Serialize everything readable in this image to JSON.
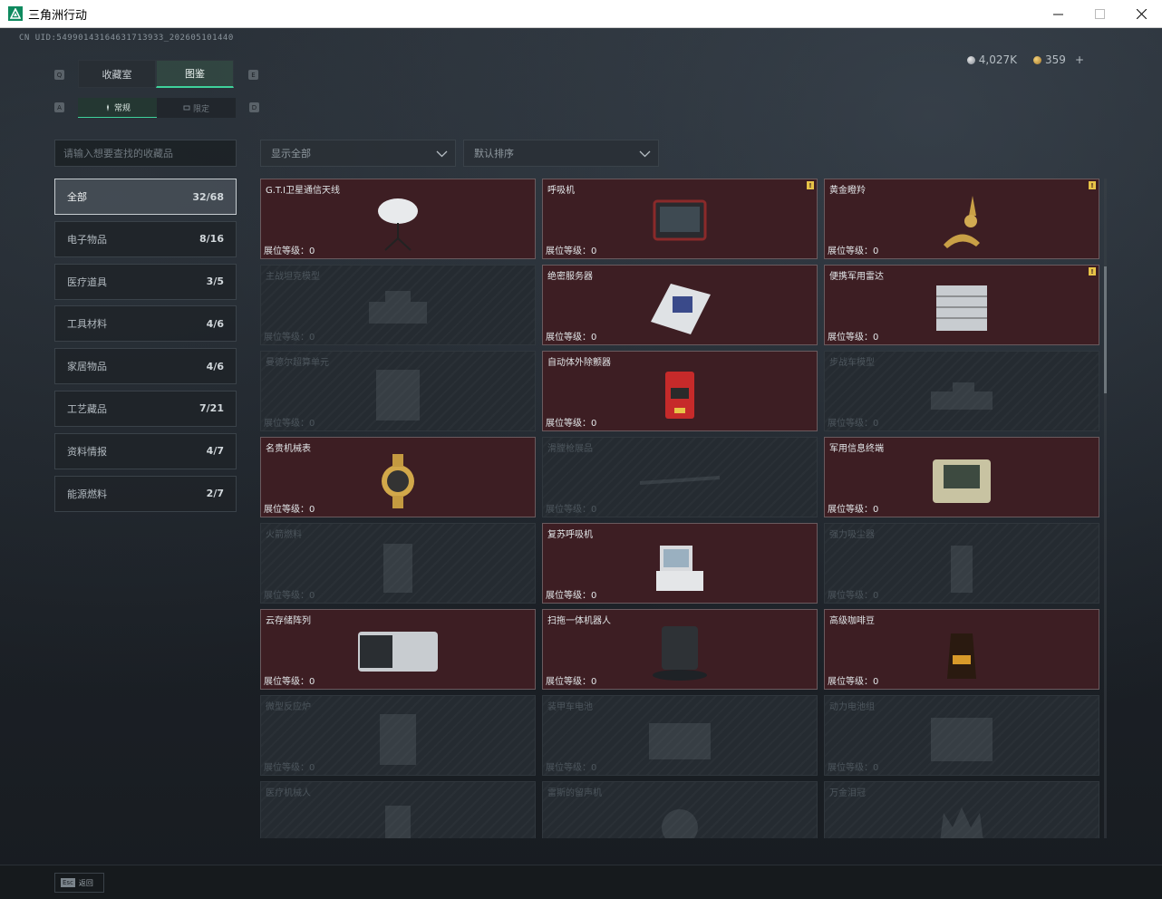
{
  "window": {
    "title": "三角洲行动"
  },
  "uid": "CN UID:5499014316463171393​3_202605101440",
  "currency": {
    "silver": "4,027K",
    "gold": "359",
    "plus": "+"
  },
  "tabs": [
    {
      "label": "收藏室",
      "active": false
    },
    {
      "label": "图鉴",
      "active": true
    }
  ],
  "subtabs": [
    {
      "label": "常规",
      "active": true
    },
    {
      "label": "限定",
      "active": false
    }
  ],
  "key_hints": {
    "q": "Q",
    "e": "E",
    "a": "A",
    "d": "D"
  },
  "search": {
    "placeholder": "请输入想要查找的收藏品"
  },
  "filters": {
    "show": "显示全部",
    "sort": "默认排序"
  },
  "categories": [
    {
      "label": "全部",
      "count": "32/68",
      "active": true
    },
    {
      "label": "电子物品",
      "count": "8/16"
    },
    {
      "label": "医疗道具",
      "count": "3/5"
    },
    {
      "label": "工具材料",
      "count": "4/6"
    },
    {
      "label": "家居物品",
      "count": "4/6"
    },
    {
      "label": "工艺藏品",
      "count": "7/21"
    },
    {
      "label": "资料情报",
      "count": "4/7"
    },
    {
      "label": "能源燃料",
      "count": "2/7"
    }
  ],
  "items": [
    {
      "name": "G.T.I卫星通信天线",
      "level": "展位等级：0",
      "owned": true,
      "flag": false,
      "icon": "satellite-dish"
    },
    {
      "name": "呼吸机",
      "level": "展位等级：0",
      "owned": true,
      "flag": true,
      "icon": "ventilator"
    },
    {
      "name": "黄金瞪羚",
      "level": "展位等级：0",
      "owned": true,
      "flag": true,
      "icon": "gold-gazelle"
    },
    {
      "name": "主战坦克模型",
      "level": "展位等级：0",
      "owned": false,
      "flag": false,
      "icon": "tank-model"
    },
    {
      "name": "绝密服务器",
      "level": "展位等级：0",
      "owned": true,
      "flag": false,
      "icon": "server"
    },
    {
      "name": "便携军用雷达",
      "level": "展位等级：0",
      "owned": true,
      "flag": true,
      "icon": "radar"
    },
    {
      "name": "曼德尔超算单元",
      "level": "展位等级：0",
      "owned": false,
      "flag": false,
      "icon": "supercomputer"
    },
    {
      "name": "自动体外除颤器",
      "level": "展位等级：0",
      "owned": true,
      "flag": false,
      "icon": "defibrillator"
    },
    {
      "name": "步战车模型",
      "level": "展位等级：0",
      "owned": false,
      "flag": false,
      "icon": "ifv-model"
    },
    {
      "name": "名贵机械表",
      "level": "展位等级：0",
      "owned": true,
      "flag": false,
      "icon": "watch"
    },
    {
      "name": "滑膛枪展品",
      "level": "展位等级：0",
      "owned": false,
      "flag": false,
      "icon": "musket"
    },
    {
      "name": "军用信息终端",
      "level": "展位等级：0",
      "owned": true,
      "flag": false,
      "icon": "terminal"
    },
    {
      "name": "火箭燃料",
      "level": "展位等级：0",
      "owned": false,
      "flag": false,
      "icon": "rocket-fuel"
    },
    {
      "name": "复苏呼吸机",
      "level": "展位等级：0",
      "owned": true,
      "flag": false,
      "icon": "resus-ventilator"
    },
    {
      "name": "强力吸尘器",
      "level": "展位等级：0",
      "owned": false,
      "flag": false,
      "icon": "vacuum"
    },
    {
      "name": "云存储阵列",
      "level": "展位等级：0",
      "owned": true,
      "flag": false,
      "icon": "storage-array"
    },
    {
      "name": "扫拖一体机器人",
      "level": "展位等级：0",
      "owned": true,
      "flag": false,
      "icon": "robot-vacuum"
    },
    {
      "name": "高级咖啡豆",
      "level": "展位等级：0",
      "owned": true,
      "flag": false,
      "icon": "coffee-beans"
    },
    {
      "name": "微型反应炉",
      "level": "展位等级：0",
      "owned": false,
      "flag": false,
      "icon": "reactor"
    },
    {
      "name": "装甲车电池",
      "level": "展位等级：0",
      "owned": false,
      "flag": false,
      "icon": "battery"
    },
    {
      "name": "动力电池组",
      "level": "展位等级：0",
      "owned": false,
      "flag": false,
      "icon": "battery-pack"
    },
    {
      "name": "医疗机械人",
      "level": "",
      "owned": false,
      "flag": false,
      "icon": "medical-robot"
    },
    {
      "name": "雷斯的留声机",
      "level": "",
      "owned": false,
      "flag": false,
      "icon": "gramophone"
    },
    {
      "name": "万金泪冠",
      "level": "",
      "owned": false,
      "flag": false,
      "icon": "crown"
    }
  ],
  "footer": {
    "esc_key": "Esc",
    "esc_label": "返回"
  },
  "colors": {
    "accent": "#3fd29b",
    "owned_bg": "#3d1e23",
    "flag": "#e7c347"
  }
}
